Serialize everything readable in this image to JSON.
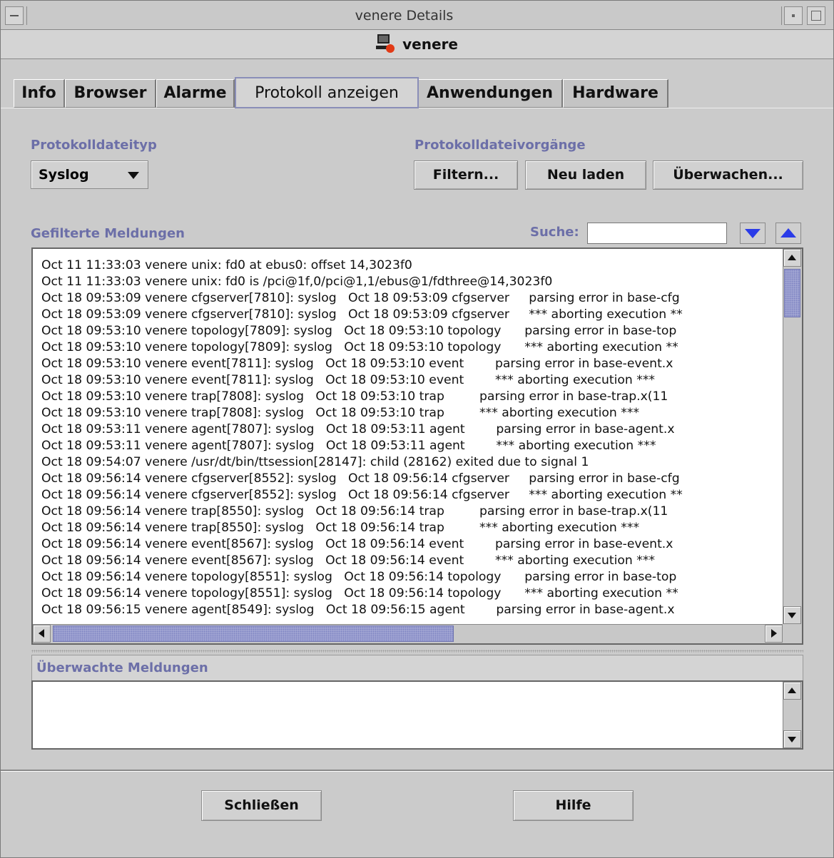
{
  "window": {
    "title": "venere Details",
    "host_name": "venere"
  },
  "tabs": [
    {
      "label": "Info",
      "active": false
    },
    {
      "label": "Browser",
      "active": false
    },
    {
      "label": "Alarme",
      "active": false
    },
    {
      "label": "Protokoll anzeigen",
      "active": true
    },
    {
      "label": "Anwendungen",
      "active": false
    },
    {
      "label": "Hardware",
      "active": false
    }
  ],
  "logfile_type": {
    "label": "Protokolldateityp",
    "selected": "Syslog"
  },
  "logfile_ops": {
    "label": "Protokolldateivorgänge",
    "filter_label": "Filtern...",
    "reload_label": "Neu laden",
    "watch_label": "Überwachen..."
  },
  "filtered": {
    "label": "Gefilterte Meldungen",
    "search_label": "Suche:",
    "search_value": "",
    "lines": [
      "Oct 11 11:33:03 venere unix: fd0 at ebus0: offset 14,3023f0",
      "Oct 11 11:33:03 venere unix: fd0 is /pci@1f,0/pci@1,1/ebus@1/fdthree@14,3023f0",
      "Oct 18 09:53:09 venere cfgserver[7810]: syslog   Oct 18 09:53:09 cfgserver     parsing error in base-cfg",
      "Oct 18 09:53:09 venere cfgserver[7810]: syslog   Oct 18 09:53:09 cfgserver     *** aborting execution **",
      "Oct 18 09:53:10 venere topology[7809]: syslog   Oct 18 09:53:10 topology      parsing error in base-top",
      "Oct 18 09:53:10 venere topology[7809]: syslog   Oct 18 09:53:10 topology      *** aborting execution **",
      "Oct 18 09:53:10 venere event[7811]: syslog   Oct 18 09:53:10 event        parsing error in base-event.x",
      "Oct 18 09:53:10 venere event[7811]: syslog   Oct 18 09:53:10 event        *** aborting execution ***",
      "Oct 18 09:53:10 venere trap[7808]: syslog   Oct 18 09:53:10 trap         parsing error in base-trap.x(11",
      "Oct 18 09:53:10 venere trap[7808]: syslog   Oct 18 09:53:10 trap         *** aborting execution ***",
      "Oct 18 09:53:11 venere agent[7807]: syslog   Oct 18 09:53:11 agent        parsing error in base-agent.x",
      "Oct 18 09:53:11 venere agent[7807]: syslog   Oct 18 09:53:11 agent        *** aborting execution ***",
      "Oct 18 09:54:07 venere /usr/dt/bin/ttsession[28147]: child (28162) exited due to signal 1",
      "Oct 18 09:56:14 venere cfgserver[8552]: syslog   Oct 18 09:56:14 cfgserver     parsing error in base-cfg",
      "Oct 18 09:56:14 venere cfgserver[8552]: syslog   Oct 18 09:56:14 cfgserver     *** aborting execution **",
      "Oct 18 09:56:14 venere trap[8550]: syslog   Oct 18 09:56:14 trap         parsing error in base-trap.x(11",
      "Oct 18 09:56:14 venere trap[8550]: syslog   Oct 18 09:56:14 trap         *** aborting execution ***",
      "Oct 18 09:56:14 venere event[8567]: syslog   Oct 18 09:56:14 event        parsing error in base-event.x",
      "Oct 18 09:56:14 venere event[8567]: syslog   Oct 18 09:56:14 event        *** aborting execution ***",
      "Oct 18 09:56:14 venere topology[8551]: syslog   Oct 18 09:56:14 topology      parsing error in base-top",
      "Oct 18 09:56:14 venere topology[8551]: syslog   Oct 18 09:56:14 topology      *** aborting execution **",
      "Oct 18 09:56:15 venere agent[8549]: syslog   Oct 18 09:56:15 agent        parsing error in base-agent.x"
    ]
  },
  "watched": {
    "label": "Überwachte Meldungen"
  },
  "footer": {
    "close_label": "Schließen",
    "help_label": "Hilfe"
  },
  "colors": {
    "section_label": "#6c6fa8",
    "window_bg": "#cbcbcb",
    "arrow_blue": "#2a3be8",
    "scroll_thumb": "#a6aad6",
    "alert_red": "#e23a16"
  },
  "icons": [
    "window-menu-icon",
    "minimize-icon",
    "maximize-icon",
    "host-computer-icon",
    "dropdown-arrow-icon",
    "search-down-icon",
    "search-up-icon"
  ]
}
